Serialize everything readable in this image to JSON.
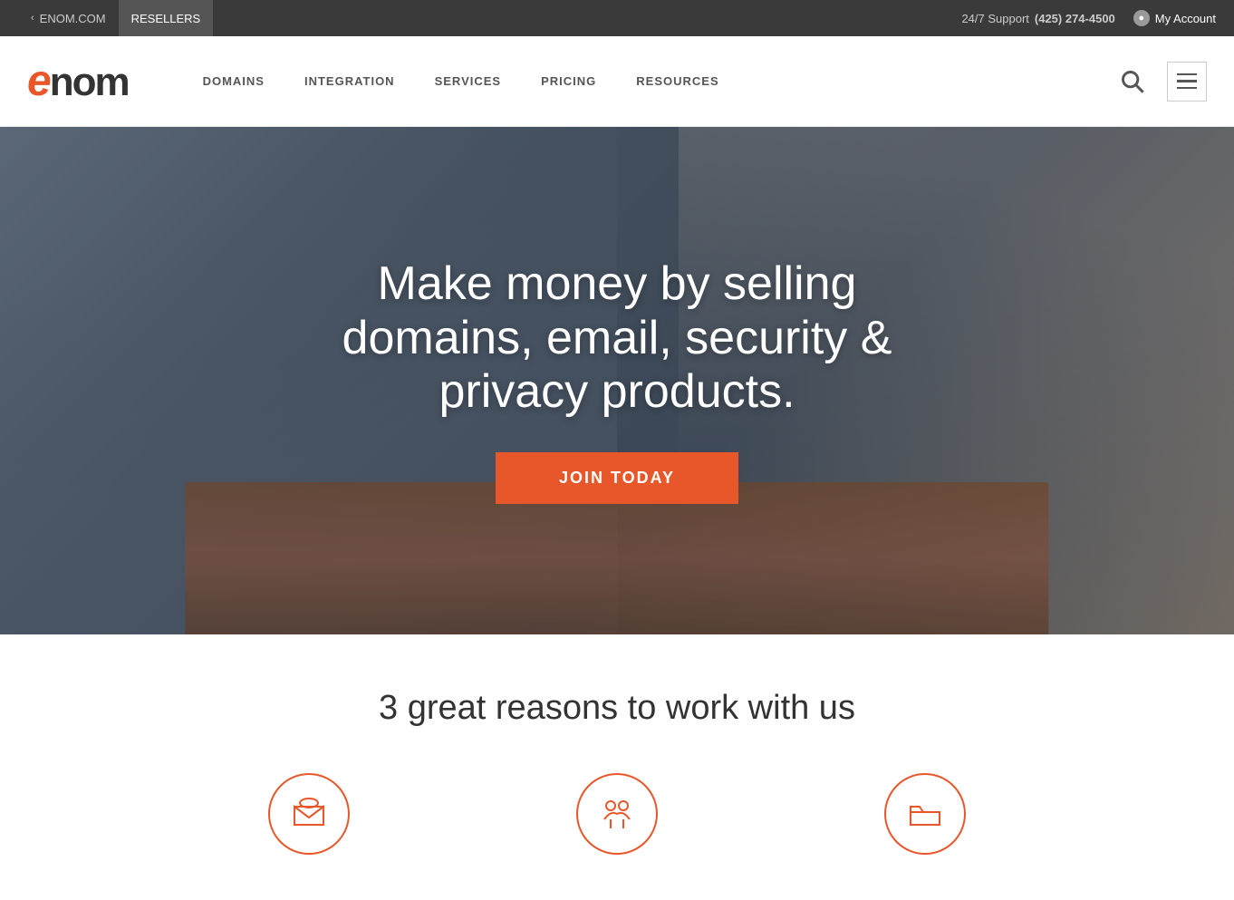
{
  "topbar": {
    "enom_link": "ENOM.COM",
    "resellers_link": "RESELLERS",
    "support_label": "24/7 Support",
    "phone": "(425) 274-4500",
    "account_label": "My Account"
  },
  "nav": {
    "logo_e": "e",
    "logo_rest": "nom",
    "items": [
      {
        "label": "DOMAINS"
      },
      {
        "label": "INTEGRATION"
      },
      {
        "label": "SERVICES"
      },
      {
        "label": "PRICING"
      },
      {
        "label": "RESOURCES"
      }
    ]
  },
  "hero": {
    "title": "Make money by selling domains, email, security & privacy products.",
    "cta_label": "JOIN TODAY"
  },
  "reasons": {
    "title": "3 great reasons to work with us",
    "items": [
      {
        "icon": "envelope-icon"
      },
      {
        "icon": "handshake-icon"
      },
      {
        "icon": "folder-icon"
      }
    ]
  }
}
